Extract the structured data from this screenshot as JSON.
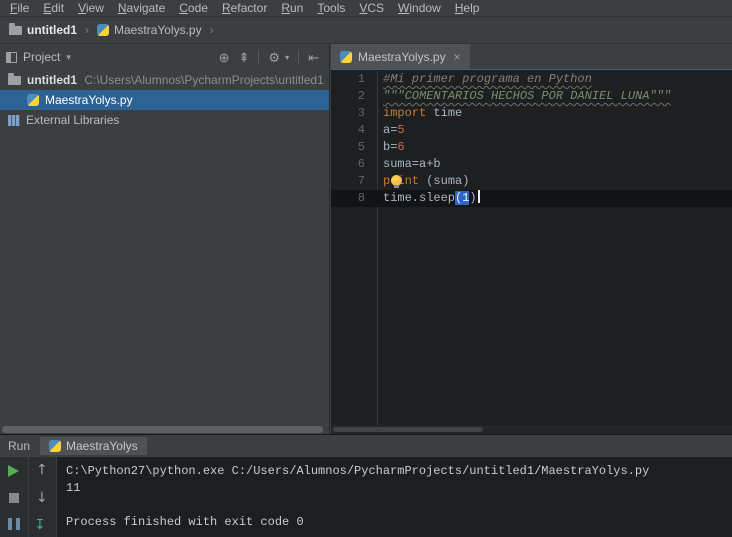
{
  "colors": {
    "panel_bg": "#3c3f41",
    "editor_bg": "#1d1f20",
    "selection_blue": "#2d6294",
    "tab_underline": "#3d6185",
    "keyword": "#cc7832",
    "number": "#d16349",
    "comment": "#808080",
    "docstring": "#7f8c6f",
    "plain_text": "#a9b7c6",
    "match_bg": "#2f65ca",
    "run_green": "#4fae4e"
  },
  "menu": {
    "items": [
      "File",
      "Edit",
      "View",
      "Navigate",
      "Code",
      "Refactor",
      "Run",
      "Tools",
      "VCS",
      "Window",
      "Help"
    ]
  },
  "breadcrumbs": {
    "project": "untitled1",
    "file": "MaestraYolys.py",
    "separator": "›"
  },
  "project_panel": {
    "title": "Project",
    "dropdown_glyph": "▾",
    "icons": {
      "locate": "⊕",
      "collapse_all": "⇞",
      "settings": "⚙",
      "settings_caret": "▾",
      "hide": "⇤"
    },
    "tree": {
      "root": {
        "name": "untitled1",
        "path": "C:\\Users\\Alumnos\\PycharmProjects\\untitled1"
      },
      "file": {
        "name": "MaestraYolys.py"
      },
      "libraries": {
        "name": "External Libraries"
      }
    }
  },
  "editor": {
    "tab": {
      "label": "MaestraYolys.py",
      "close_glyph": "×"
    },
    "lines": [
      {
        "n": 1,
        "tokens": [
          {
            "t": "comment",
            "s": "#Mi primer programa en Python"
          }
        ]
      },
      {
        "n": 2,
        "tokens": [
          {
            "t": "docstring",
            "s": "\"\"\"COMENTARIOS HECHOS POR DANIEL LUNA\"\"\""
          }
        ]
      },
      {
        "n": 3,
        "tokens": [
          {
            "t": "keyword",
            "s": "import"
          },
          {
            "t": "plain",
            "s": " time"
          }
        ]
      },
      {
        "n": 4,
        "tokens": [
          {
            "t": "plain",
            "s": "a="
          },
          {
            "t": "number",
            "s": "5"
          }
        ]
      },
      {
        "n": 5,
        "tokens": [
          {
            "t": "plain",
            "s": "b="
          },
          {
            "t": "number",
            "s": "6"
          }
        ]
      },
      {
        "n": 6,
        "tokens": [
          {
            "t": "plain",
            "s": "suma=a+b"
          }
        ]
      },
      {
        "n": 7,
        "bulb": true,
        "tokens": [
          {
            "t": "keyword",
            "s": "print"
          },
          {
            "t": "plain",
            "s": " (suma)"
          }
        ]
      },
      {
        "n": 8,
        "active": true,
        "cursor": true,
        "tokens": [
          {
            "t": "plain",
            "s": "time.sleep"
          },
          {
            "t": "match",
            "s": "(1"
          },
          {
            "t": "plain",
            "s": ")"
          }
        ]
      }
    ]
  },
  "run_panel": {
    "label": "Run",
    "tab": "MaestraYolys",
    "icons": {
      "up": "↑",
      "down": "↓",
      "scroll_end": "↧"
    },
    "console": [
      "C:\\Python27\\python.exe C:/Users/Alumnos/PycharmProjects/untitled1/MaestraYolys.py",
      "11",
      "",
      "Process finished with exit code 0"
    ]
  }
}
